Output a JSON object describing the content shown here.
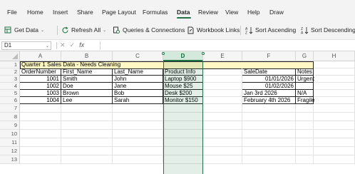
{
  "menu": {
    "items": [
      "File",
      "Home",
      "Insert",
      "Share",
      "Page Layout",
      "Formulas",
      "Data",
      "Review",
      "View",
      "Help",
      "Draw"
    ],
    "active": "Data"
  },
  "ribbon": {
    "get_data": "Get Data",
    "refresh_all": "Refresh All",
    "queries": "Queries & Connections",
    "workbook_links": "Workbook Links",
    "sort_asc": "Sort Ascending",
    "sort_desc": "Sort Descending"
  },
  "formula_bar": {
    "name_box": "D1",
    "fx": "fx",
    "cancel": "✕",
    "enter": "✓",
    "value": ""
  },
  "columns": [
    "A",
    "B",
    "C",
    "D",
    "E",
    "F",
    "G",
    "H"
  ],
  "selected_column": "D",
  "rows": [
    "1",
    "2",
    "3",
    "4",
    "5",
    "6",
    "7",
    "8",
    "9",
    "10",
    "11",
    "12",
    "13"
  ],
  "sheet": {
    "title": "Quarter 1 Sales Data - Needs Cleaning",
    "headers": {
      "A": "OrderNumber",
      "B": "First_Name",
      "C": "Last_Name",
      "D": "Product Info",
      "F": "SaleDate",
      "G": "Notes"
    },
    "data": [
      {
        "A": "1001",
        "B": "Smith",
        "C": "John",
        "D": "Laptop $900",
        "F": "01/01/2026",
        "G": "Urgent"
      },
      {
        "A": "1002",
        "B": "Doe",
        "C": "Jane",
        "D": "Mouse $25",
        "F": "01/02/2026",
        "G": ""
      },
      {
        "A": "1003",
        "B": "Brown",
        "C": "Bob",
        "D": "Desk $200",
        "F": "Jan 3rd 2026",
        "G": "N/A"
      },
      {
        "A": "1004",
        "B": "Lee",
        "C": "Sarah",
        "D": "Monitor $150",
        "F": "February 4th 2026",
        "G": "Fragile"
      }
    ]
  },
  "colors": {
    "accent": "#217346",
    "title_fill": "#fff8c5",
    "selection": "#d3e9dc"
  }
}
